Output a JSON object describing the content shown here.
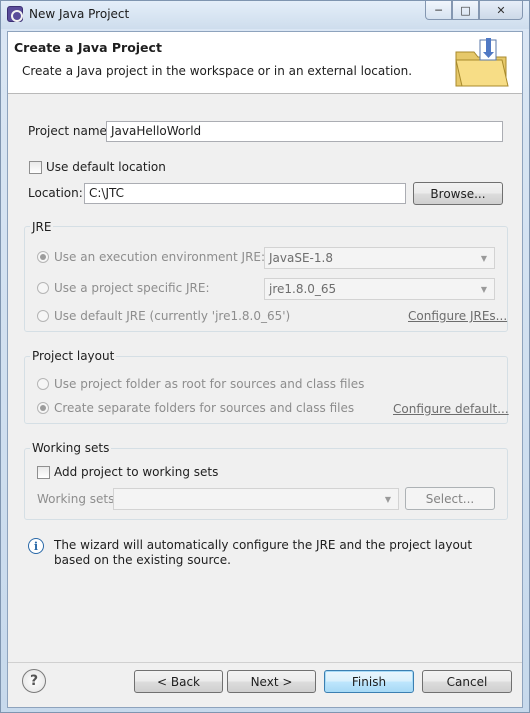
{
  "window": {
    "title": "New Java Project"
  },
  "header": {
    "title": "Create a Java Project",
    "description": "Create a Java project in the workspace or in an external location."
  },
  "project": {
    "name_label": "Project name:",
    "name_value": "JavaHelloWorld",
    "use_default_location_label": "Use default location",
    "use_default_location_checked": false,
    "location_label": "Location:",
    "location_value": "C:\\JTC",
    "browse_label": "Browse..."
  },
  "jre": {
    "group_label": "JRE",
    "option_env_label": "Use an execution environment JRE:",
    "env_value": "JavaSE-1.8",
    "option_specific_label": "Use a project specific JRE:",
    "specific_value": "jre1.8.0_65",
    "option_default_label": "Use default JRE (currently 'jre1.8.0_65')",
    "configure_link": "Configure JREs...",
    "selected": "env"
  },
  "layout": {
    "group_label": "Project layout",
    "option_root_label": "Use project folder as root for sources and class files",
    "option_separate_label": "Create separate folders for sources and class files",
    "configure_link": "Configure default...",
    "selected": "separate"
  },
  "working_sets": {
    "group_label": "Working sets",
    "add_label": "Add project to working sets",
    "add_checked": false,
    "sets_label": "Working sets:",
    "sets_value": "",
    "select_label": "Select..."
  },
  "info": {
    "icon": "info-icon",
    "message": "The wizard will automatically configure the JRE and the project layout based on the existing source."
  },
  "footer": {
    "help_icon": "help-icon",
    "back_label": "< Back",
    "next_label": "Next >",
    "finish_label": "Finish",
    "cancel_label": "Cancel"
  },
  "colors": {
    "title_bar": "#d6e4f3",
    "client_background": "#f0f0f0",
    "header_background": "#ffffff",
    "link": "#1e1e1e"
  }
}
